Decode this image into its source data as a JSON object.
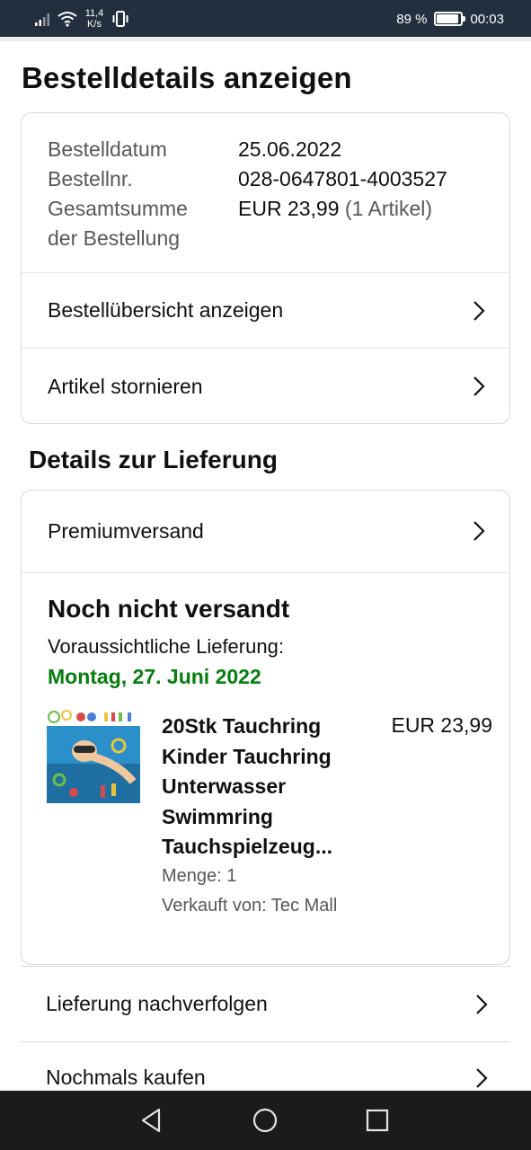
{
  "status_bar": {
    "net_speed": "11,4 K/s",
    "battery_percent": "89 %",
    "battery_level": 0.89,
    "time": "00:03",
    "icons": [
      "signal-icon",
      "wifi-icon",
      "vibrate-icon",
      "battery-icon"
    ]
  },
  "page": {
    "title": "Bestelldetails anzeigen"
  },
  "order_summary": {
    "date_label": "Bestelldatum",
    "date_value": "25.06.2022",
    "number_label": "Bestellnr.",
    "number_value": "028-0647801-4003527",
    "total_label_line1": "Gesamtsumme",
    "total_label_line2": "der Bestellung",
    "total_value": "EUR 23,99",
    "total_items": "(1 Artikel)"
  },
  "order_actions": [
    {
      "label": "Bestellübersicht anzeigen",
      "icon": "chevron-right-icon"
    },
    {
      "label": "Artikel stornieren",
      "icon": "chevron-right-icon"
    }
  ],
  "delivery": {
    "section_title": "Details zur Lieferung",
    "shipping_method": "Premiumversand",
    "status": "Noch nicht versandt",
    "expected_label": "Voraussichtliche Lieferung:",
    "expected_date": "Montag, 27. Juni 2022",
    "accent_color": "#067d0e"
  },
  "product": {
    "title": "20Stk Tauchring Kinder Tauchring Unterwasser Swimmring Tauchspielzeug...",
    "price": "EUR 23,99",
    "quantity": "Menge: 1",
    "seller": "Verkauft von: Tec Mall"
  },
  "bottom_actions": [
    {
      "label": "Lieferung nachverfolgen",
      "icon": "chevron-right-icon"
    },
    {
      "label": "Nochmals kaufen",
      "icon": "chevron-right-icon"
    }
  ],
  "system_nav": {
    "buttons": [
      "back-icon",
      "home-icon",
      "recents-icon"
    ]
  }
}
